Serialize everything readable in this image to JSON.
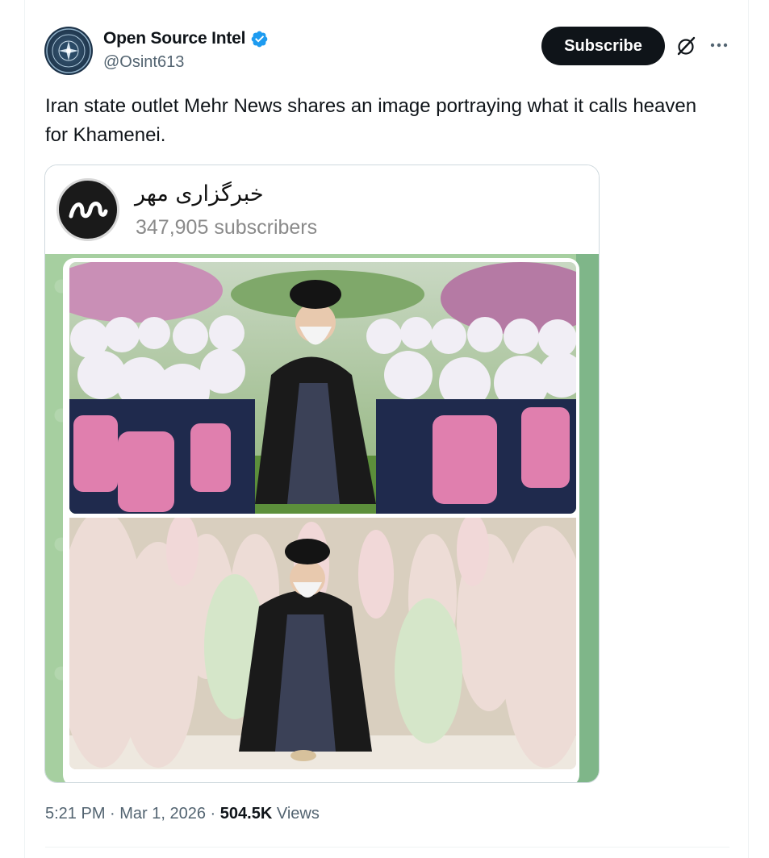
{
  "author": {
    "name": "Open Source Intel",
    "handle": "@Osint613",
    "verified_icon": "verified-badge-icon",
    "accent_color": "#1d9bf0"
  },
  "actions": {
    "subscribe_label": "Subscribe",
    "grok_icon": "grok-icon",
    "more_icon": "more-icon"
  },
  "tweet": {
    "text": "Iran state outlet Mehr News shares an image portraying what it calls heaven for Khamenei."
  },
  "media": {
    "channel_name": "خبرگزاری مهر",
    "channel_subscribers": "347,905 subscribers",
    "top_image": "AI-style image of cleric sitting on grass among schoolgirls in white hijabs with pink backpacks in a flower garden",
    "bottom_image": "photo of cleric sitting among girls in floral chadors"
  },
  "meta": {
    "time": "5:21 PM",
    "separator": " · ",
    "date": "Mar 1, 2026",
    "views_count": "504.5K",
    "views_label": "Views"
  }
}
